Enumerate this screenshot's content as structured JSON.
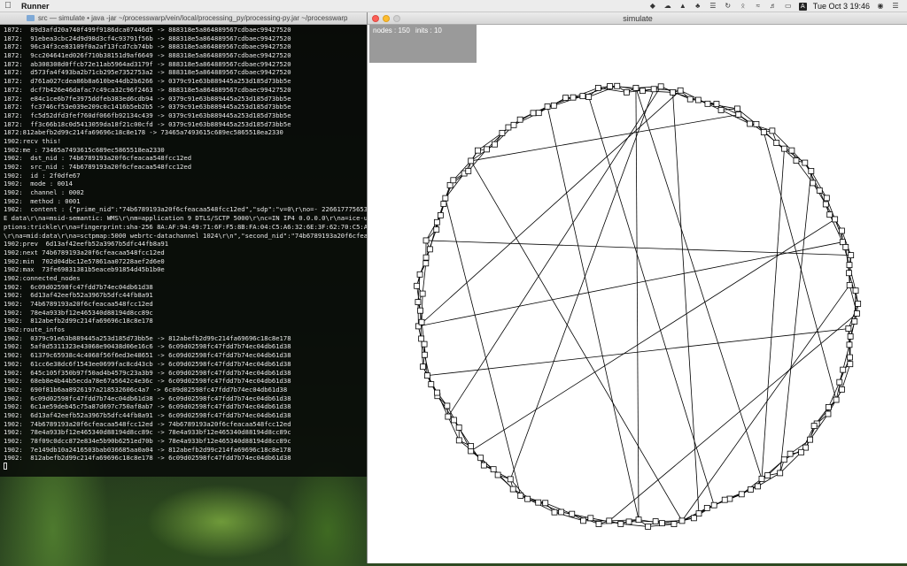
{
  "menubar": {
    "app_name": "Runner",
    "clock": "Tue Oct 3  19:46",
    "input_badge": "A"
  },
  "terminal": {
    "title": "src — simulate • java -jar ~/processwarp/vein/local/processing_py/processing-py.jar ~/processwarp",
    "lines": [
      "1872:  89d3afd20a740f499f9186dca07446d5 -> 888318e5a864889567cdbaec99427520",
      "1872:  91ebea3cbc24d9d98d3cf4c93791f56b -> 888318e5a864889567cdbaec99427520",
      "1872:  96c34f3ce83109f0a2af13fcd7cb74bb -> 888318e5a864889567cdbaec99427520",
      "1872:  9cc204641ed026f710b38151d9af6649 -> 888318e5a864889567cdbaec99427520",
      "1872:  ab308308d0ffcb72e11ab5964ad3179f -> 888318e5a864889567cdbaec99427520",
      "1872:  d573fa4f493ba2b71cb295e7352753a2 -> 888318e5a864889567cdbaec99427520",
      "1872:  d761a027cdea86b8a610be44db2b6266 -> 0379c91e63b889445a253d185d73bb5e",
      "1872:  dcf7b426e46dafac7c49ca32c96f2463 -> 888318e5a864889567cdbaec99427520",
      "1872:  e84c1ce6b7fe3975ddfeb383ed6cdb94 -> 0379c91e63b889445a253d185d73bb5e",
      "1872:  fc3746cf53e039e209c0c1416b5eb2b5 -> 0379c91e63b889445a253d185d73bb5e",
      "1872:  fc5d52dfd3fef760df066fb92134c439 -> 0379c91e63b889445a253d185d73bb5e",
      "1872:  ff3c66b18c0d5413059da18f21c00cfd -> 0379c91e63b889445a253d185d73bb5e",
      "1872:812abefb2d99c214fa69696c18c8e178 -> 73465a7493615c689ec5865518ea2330",
      "1902:recv this!",
      "1902:me : 73465a7493615c689ec5865518ea2330",
      "1902:  dst_nid : 74b6789193a20f6cfeacaa548fcc12ed",
      "1902:  src_nid : 74b6789193a20f6cfeacaa548fcc12ed",
      "1902:  id : 2f0dfe67",
      "1902:  mode : 0014",
      "1902:  channel : 0002",
      "1902:  method : 0001",
      "1902:  content : {\"prime_nid\":\"74b6789193a20f6cfeacaa548fcc12ed\",\"sdp\":\"v=0\\r\\no=- 22661777565304",
      "E data\\r\\na=msid-semantic: WMS\\r\\nm=application 9 DTLS/SCTP 5000\\r\\nc=IN IP4 0.0.0.0\\r\\na=ice-u",
      "ptions:trickle\\r\\na=fingerprint:sha-256 8A:AF:94:49:71:6F:F5:8B:FA:04:C5:A6:32:6E:3F:62:70:C5:A0",
      "\\r\\na=mid:data\\r\\na=sctpmap:5000 webrtc-datachannel 1024\\r\\n\",\"second_nid\":\"74b6789193a20f6cfeaca",
      "1902:prev  6d13af42eefb52a3967b5dfc44fb8a91",
      "1902:next 74b6789193a20f6cfeacaa548fcc12ed",
      "1902:min  702d04dbc12e57861aa07228aef2d6e0",
      "1902:max  73fe69831381b5eaceb91854d45b1b0e",
      "1902:connected_nodes",
      "1902:  6c09d02598fc47fdd7b74ec04db61d38",
      "1902:  6d13af42eefb52a3967b5dfc44fb8a91",
      "1902:  74b6789193a20f6cfeacaa548fcc12ed",
      "1902:  78e4a933bf12e465340d88194d8cc89c",
      "1902:  812abefb2d99c214fa69696c18c8e178",
      "1902:route_infos",
      "1902:  0379c91e63b889445a253d185d73bb5e -> 812abefb2d99c214fa69696c18c8e178",
      "1902:  5af0d5311323e43068e90438d06e16c6 -> 6c09d02598fc47fdd7b74ec04db61d38",
      "1902:  61379c65938c4c4068f56f6ed3e48651 -> 6c09d02598fc47fdd7b74ec04db61d38",
      "1902:  61cc6e38dc6f1543ee0699fac8cd43cb -> 6c09d02598fc47fdd7b74ec04db61d38",
      "1902:  645c105f350b97f50ad4b4579c23a3b9 -> 6c09d02598fc47fdd7b74ec04db61d38",
      "1902:  68eb8e4b44b5ecda78e67a5642c4e36c -> 6c09d02598fc47fdd7b74ec04db61d38",
      "1902:  690f81b6aa8926197a218532606c4a7 -> 6c09d02598fc47fdd7b74ec04db61d38",
      "1902:  6c09d02598fc47fdd7b74ec04db61d38 -> 6c09d02598fc47fdd7b74ec04db61d38",
      "1902:  6c1ae59deb45c75a87d697c750af8ab7 -> 6c09d02598fc47fdd7b74ec04db61d38",
      "1902:  6d13af42eefb52a3967b5dfc44fb8a91 -> 6c09d02598fc47fdd7b74ec04db61d38",
      "1902:  74b6789193a20f6cfeacaa548fcc12ed -> 74b6789193a20f6cfeacaa548fcc12ed",
      "1902:  78e4a933bf12e465340d88194d8cc89c -> 78e4a933bf12e465340d88194d8cc89c",
      "1902:  78f09c0dcc872e834e5b90b6251ed70b -> 78e4a933bf12e465340d88194d8cc89c",
      "1902:  7e149db10a2416503bab036685aa0a04 -> 812abefb2d99c214fa69696c18c8e178",
      "1902:  812abefb2d99c214fa69696c18c8e178 -> 6c09d02598fc47fdd7b74ec04db61d38"
    ]
  },
  "simulate": {
    "title": "simulate",
    "stats_nodes": "nodes : 150",
    "stats_inits": "inits : 10"
  }
}
